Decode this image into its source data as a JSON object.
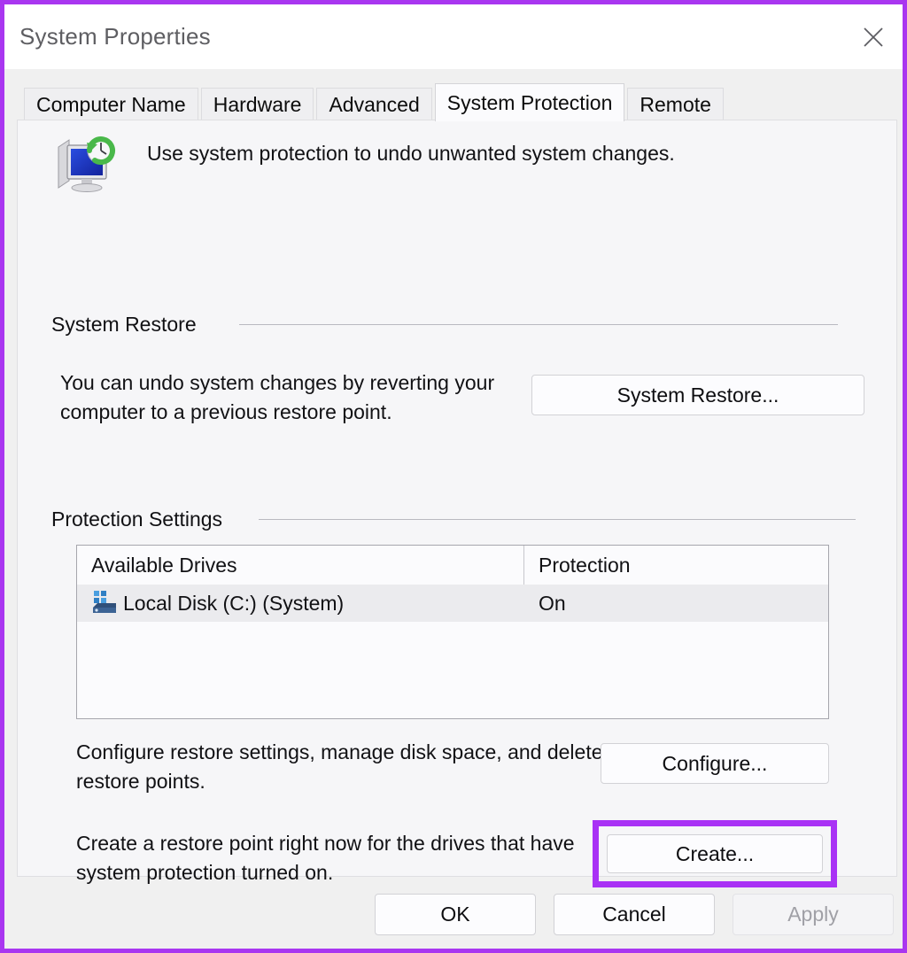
{
  "window": {
    "title": "System Properties",
    "close_icon": "close-icon",
    "annotation_color": "#a936f0"
  },
  "tabs": [
    {
      "label": "Computer Name",
      "selected": false
    },
    {
      "label": "Hardware",
      "selected": false
    },
    {
      "label": "Advanced",
      "selected": false
    },
    {
      "label": "System Protection",
      "selected": true
    },
    {
      "label": "Remote",
      "selected": false
    }
  ],
  "header": {
    "icon": "system-protection-icon",
    "description": "Use system protection to undo unwanted system changes."
  },
  "system_restore": {
    "group_label": "System Restore",
    "description": "You can undo system changes by reverting your computer to a previous restore point.",
    "button_label": "System Restore..."
  },
  "protection_settings": {
    "group_label": "Protection Settings",
    "columns": [
      "Available Drives",
      "Protection"
    ],
    "rows": [
      {
        "icon": "hard-drive-icon",
        "drive": "Local Disk (C:) (System)",
        "protection": "On",
        "selected": true
      }
    ],
    "configure": {
      "description": "Configure restore settings, manage disk space, and delete restore points.",
      "button_label": "Configure..."
    },
    "create": {
      "description": "Create a restore point right now for the drives that have system protection turned on.",
      "button_label": "Create...",
      "highlighted": true,
      "highlight_color": "#a932f5"
    }
  },
  "footer": {
    "ok_label": "OK",
    "cancel_label": "Cancel",
    "apply_label": "Apply",
    "apply_disabled": true
  }
}
